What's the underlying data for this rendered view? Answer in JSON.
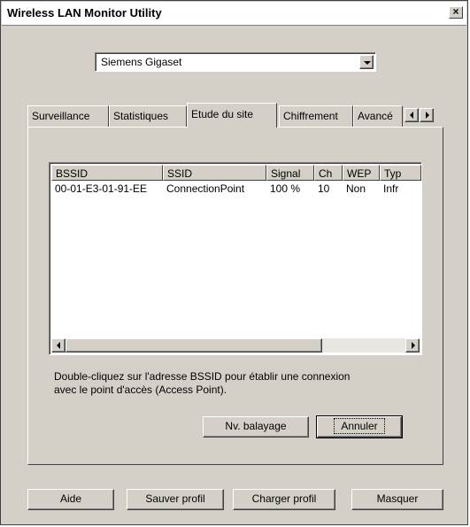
{
  "window": {
    "title": "Wireless LAN Monitor Utility",
    "close_label": "×"
  },
  "adapter_select": {
    "value": "Siemens Gigaset"
  },
  "tabs": [
    {
      "label": "Surveillance"
    },
    {
      "label": "Statistiques"
    },
    {
      "label": "Etude du site"
    },
    {
      "label": "Chiffrement"
    },
    {
      "label": "Avancé"
    }
  ],
  "site_survey": {
    "columns": [
      "BSSID",
      "SSID",
      "Signal",
      "Ch",
      "WEP",
      "Typ"
    ],
    "rows": [
      [
        "00-01-E3-01-91-EE",
        "ConnectionPoint",
        "100 %",
        "10",
        "Non",
        "Infr"
      ]
    ],
    "hint_line1": "Double-cliquez sur l'adresse BSSID pour établir une connexion",
    "hint_line2": "avec le point d'accès (Access Point).",
    "rescan_label": "Nv. balayage",
    "cancel_label": "Annuler"
  },
  "footer": {
    "help_label": "Aide",
    "save_profile_label": "Sauver profil",
    "load_profile_label": "Charger profil",
    "hide_label": "Masquer"
  }
}
